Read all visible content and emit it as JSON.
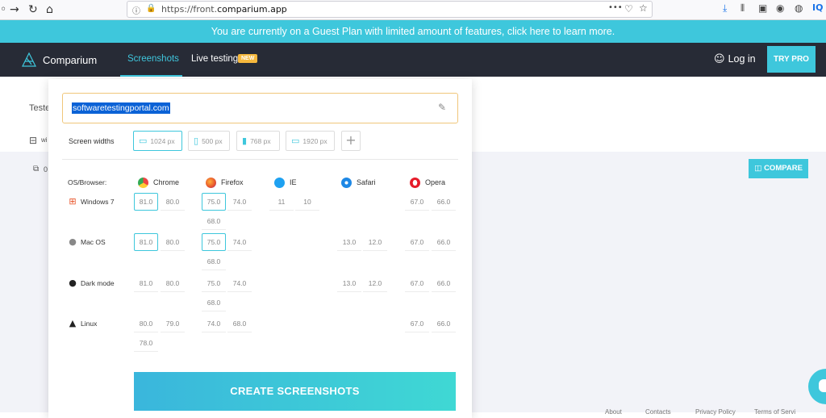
{
  "browser": {
    "url_prefix": "https://front.",
    "url_domain": "comparium.app",
    "url_suffix": "",
    "menu_dots": "•••"
  },
  "banner": {
    "text": "You are currently on a Guest Plan with limited amount of features, click here to learn more."
  },
  "nav": {
    "brand": "Comparium",
    "screenshots": "Screenshots",
    "live_testing": "Live testing",
    "new_badge": "NEW",
    "login": "Log in",
    "try_pro": "TRY PRO"
  },
  "background": {
    "tested_label": "Teste",
    "w_label": "wi",
    "o_label": "0",
    "compare": "COMPARE",
    "footer": [
      "About",
      "Contacts",
      "Privacy Policy",
      "Terms of Servi"
    ]
  },
  "panel": {
    "url_value": "softwaretestingportal.com",
    "screen_widths_label": "Screen widths",
    "widths": [
      {
        "label": "1024 px",
        "icon": "laptop-icon",
        "active": true
      },
      {
        "label": "500 px",
        "icon": "mobile-icon",
        "active": false
      },
      {
        "label": "768 px",
        "icon": "tablet-icon",
        "active": false
      },
      {
        "label": "1920 px",
        "icon": "desktop-icon",
        "active": false
      }
    ],
    "os_browser_label": "OS/Browser:",
    "browsers": [
      "Chrome",
      "Firefox",
      "IE",
      "Safari",
      "Opera"
    ],
    "os": [
      "Windows 7",
      "Mac OS",
      "Dark mode",
      "Linux"
    ],
    "versions": {
      "win_chrome": [
        "81.0",
        "80.0"
      ],
      "win_firefox": [
        "75.0",
        "74.0",
        "68.0"
      ],
      "win_ie": [
        "11",
        "10"
      ],
      "win_opera": [
        "67.0",
        "66.0"
      ],
      "mac_chrome": [
        "81.0",
        "80.0"
      ],
      "mac_firefox": [
        "75.0",
        "74.0",
        "68.0"
      ],
      "mac_safari": [
        "13.0",
        "12.0"
      ],
      "mac_opera": [
        "67.0",
        "66.0"
      ],
      "dark_chrome": [
        "81.0",
        "80.0"
      ],
      "dark_firefox": [
        "75.0",
        "74.0",
        "68.0"
      ],
      "dark_safari": [
        "13.0",
        "12.0"
      ],
      "dark_opera": [
        "67.0",
        "66.0"
      ],
      "linux_chrome": [
        "80.0",
        "79.0",
        "78.0"
      ],
      "linux_firefox": [
        "74.0",
        "68.0"
      ],
      "linux_opera": [
        "67.0",
        "66.0"
      ]
    },
    "create_button": "CREATE SCREENSHOTS"
  },
  "colors": {
    "accent": "#3ec7dc",
    "nav_bg": "#272b36",
    "selection": "#0b62d6"
  }
}
